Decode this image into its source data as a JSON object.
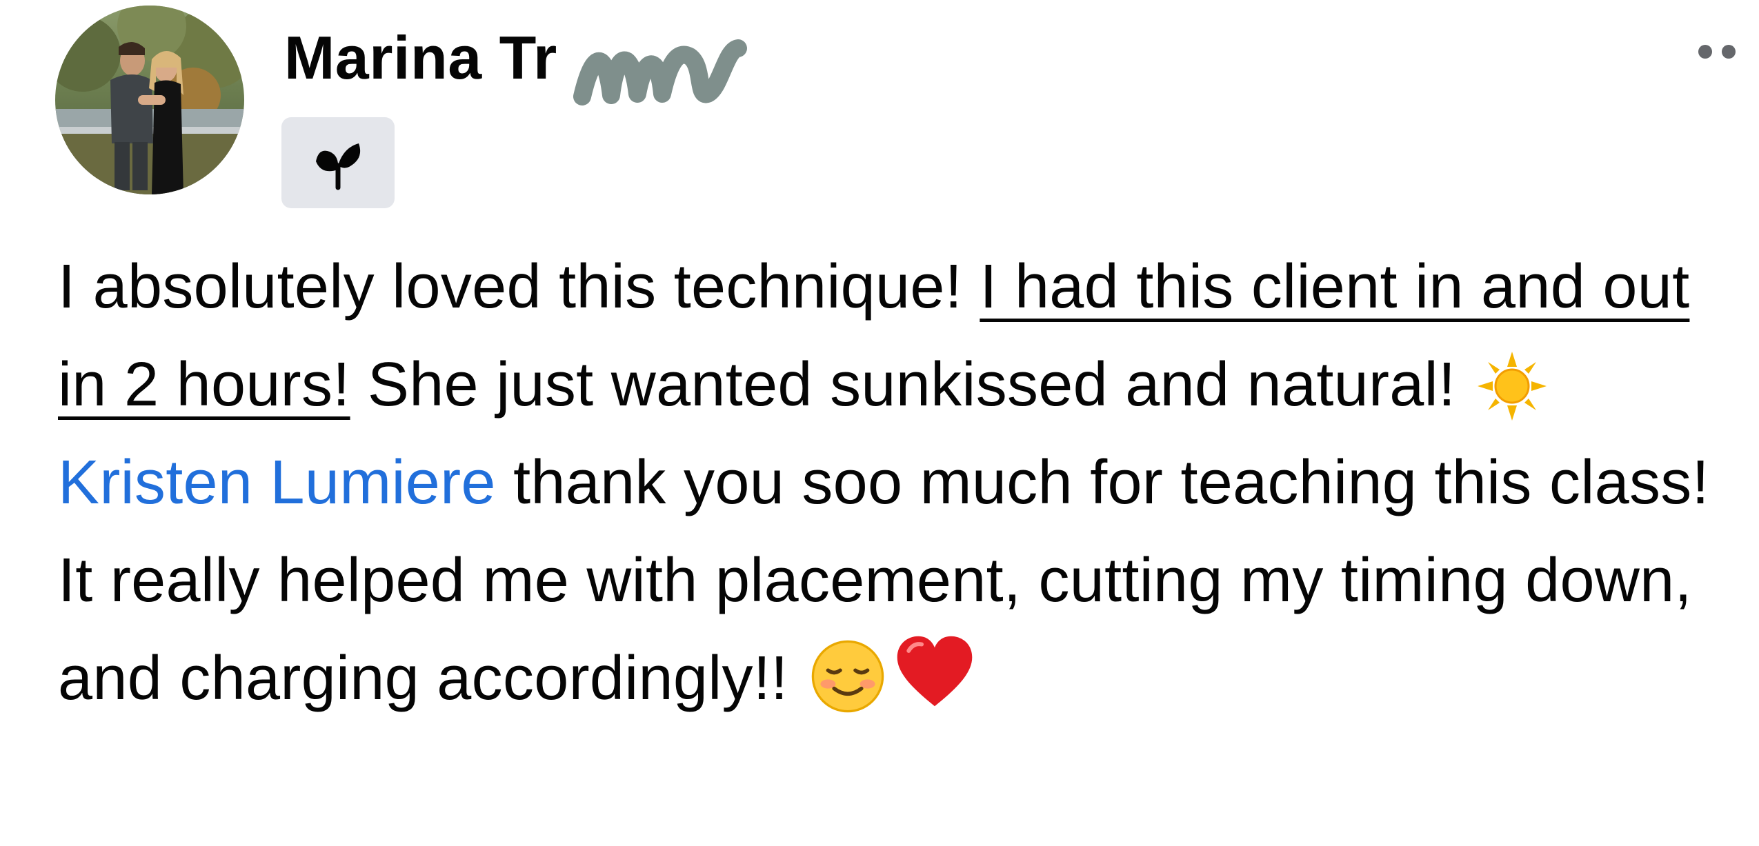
{
  "post": {
    "author": {
      "name": "Marina Tr",
      "avatar_icon": "profile-photo",
      "badge_icon": "new-member-sprout-icon"
    },
    "more_options_icon": "ellipsis-icon",
    "text": {
      "part1": "I absolutely loved this technique! ",
      "underlined": "I had this client in and out in 2 hours!",
      "part2": " She just wanted sunkissed and natural! ",
      "mention": "Kristen Lumiere",
      "part3": " thank you soo much for teaching this class! It really helped me with placement, cutting my timing down, and charging accordingly!! "
    },
    "emojis": [
      "sun-emoji",
      "smiling-face-emoji",
      "red-heart-emoji"
    ]
  },
  "colors": {
    "text": "#050505",
    "mention": "#216fdb",
    "badge_bg": "#e4e6eb",
    "redaction": "#7f8f8c"
  }
}
